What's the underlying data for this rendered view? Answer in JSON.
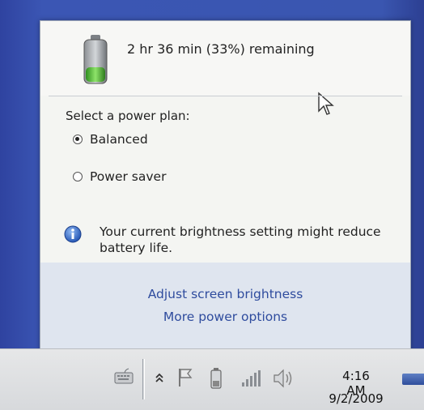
{
  "battery": {
    "status": "2 hr 36 min (33%) remaining",
    "charge_fraction": 0.33
  },
  "power_plan": {
    "label": "Select a power plan:",
    "options": [
      {
        "label": "Balanced",
        "selected": true
      },
      {
        "label": "Power saver",
        "selected": false
      }
    ]
  },
  "notice": {
    "text": "Your current brightness setting might reduce battery life."
  },
  "links": {
    "brightness": "Adjust screen brightness",
    "more_options": "More power options"
  },
  "taskbar": {
    "time": "4:16 AM",
    "date": "9/2/2009",
    "icons": [
      "keyboard-icon",
      "show-hidden-icons-icon",
      "action-center-flag-icon",
      "battery-icon",
      "network-signal-icon",
      "volume-icon"
    ]
  },
  "colors": {
    "link": "#2f4c9e",
    "desktop": "#3b53a6",
    "battery_green": "#4caf32"
  }
}
